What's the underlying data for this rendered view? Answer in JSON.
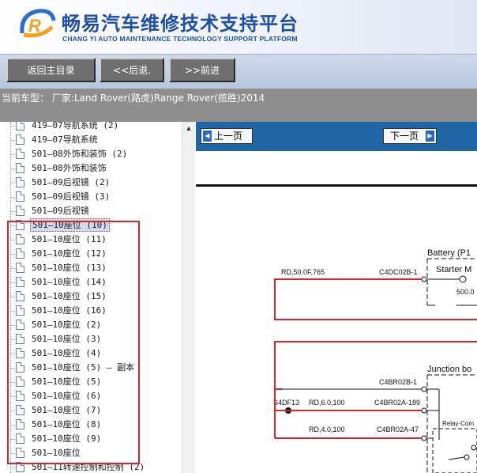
{
  "header": {
    "brand_cn": "畅易汽车维修技术支持平台",
    "brand_en": "CHANG YI AUTO MAINTENANCE TECHNOLOGY SUPPORT PLATFORM",
    "brand_color": "#1d4fa4"
  },
  "nav": {
    "home": "返回主目录",
    "back": "<<后退.",
    "forward": ">>前进"
  },
  "vehicle": {
    "text": "当前车型： 厂家:Land Rover(路虎)Range Rover(揽胜)2014"
  },
  "tree": {
    "items": [
      {
        "label": "419—07导航系统 (2)"
      },
      {
        "label": "419—07导航系统"
      },
      {
        "label": "501—08外饰和装饰 (2)"
      },
      {
        "label": "501—08外饰和装饰"
      },
      {
        "label": "501—09后视镜 (2)"
      },
      {
        "label": "501—09后视镜 (3)"
      },
      {
        "label": "501—09后视镜"
      },
      {
        "label": "501—10座位 (10)"
      },
      {
        "label": "501—10座位 (11)"
      },
      {
        "label": "501—10座位 (12)"
      },
      {
        "label": "501—10座位 (13)"
      },
      {
        "label": "501—10座位 (14)"
      },
      {
        "label": "501—10座位 (15)"
      },
      {
        "label": "501—10座位 (16)"
      },
      {
        "label": "501—10座位 (2)"
      },
      {
        "label": "501—10座位 (3)"
      },
      {
        "label": "501—10座位 (4)"
      },
      {
        "label": "501—10座位 (5) — 副本"
      },
      {
        "label": "501—10座位 (5)"
      },
      {
        "label": "501—10座位 (6)"
      },
      {
        "label": "501—10座位 (7)"
      },
      {
        "label": "501—10座位 (8)"
      },
      {
        "label": "501—10座位 (9)"
      },
      {
        "label": "501—10座位"
      },
      {
        "label": "501—11转速控制和控制 (2)"
      }
    ],
    "selected_label": "501—10座位 (10)",
    "highlight_color": "#d9232d"
  },
  "doc": {
    "prev": "上一页",
    "next": "下一页",
    "toolbar_color": "#1f66a6"
  },
  "schematic": {
    "battery": "Battery (P1",
    "starter": "Starter M",
    "value_500": "500.0",
    "wire1": "RD,50.0F,765",
    "conn1": "C4DC02B-1",
    "junction": "Junction bo",
    "conn2": "C4BR02B-1",
    "splice": "S4DF13",
    "wire2": "RD,6.0,100",
    "conn3": "C4BR02A-189",
    "wire3": "RD,4.0,100",
    "conn4": "C4BR02A-47",
    "relay": "Relay-Com"
  }
}
